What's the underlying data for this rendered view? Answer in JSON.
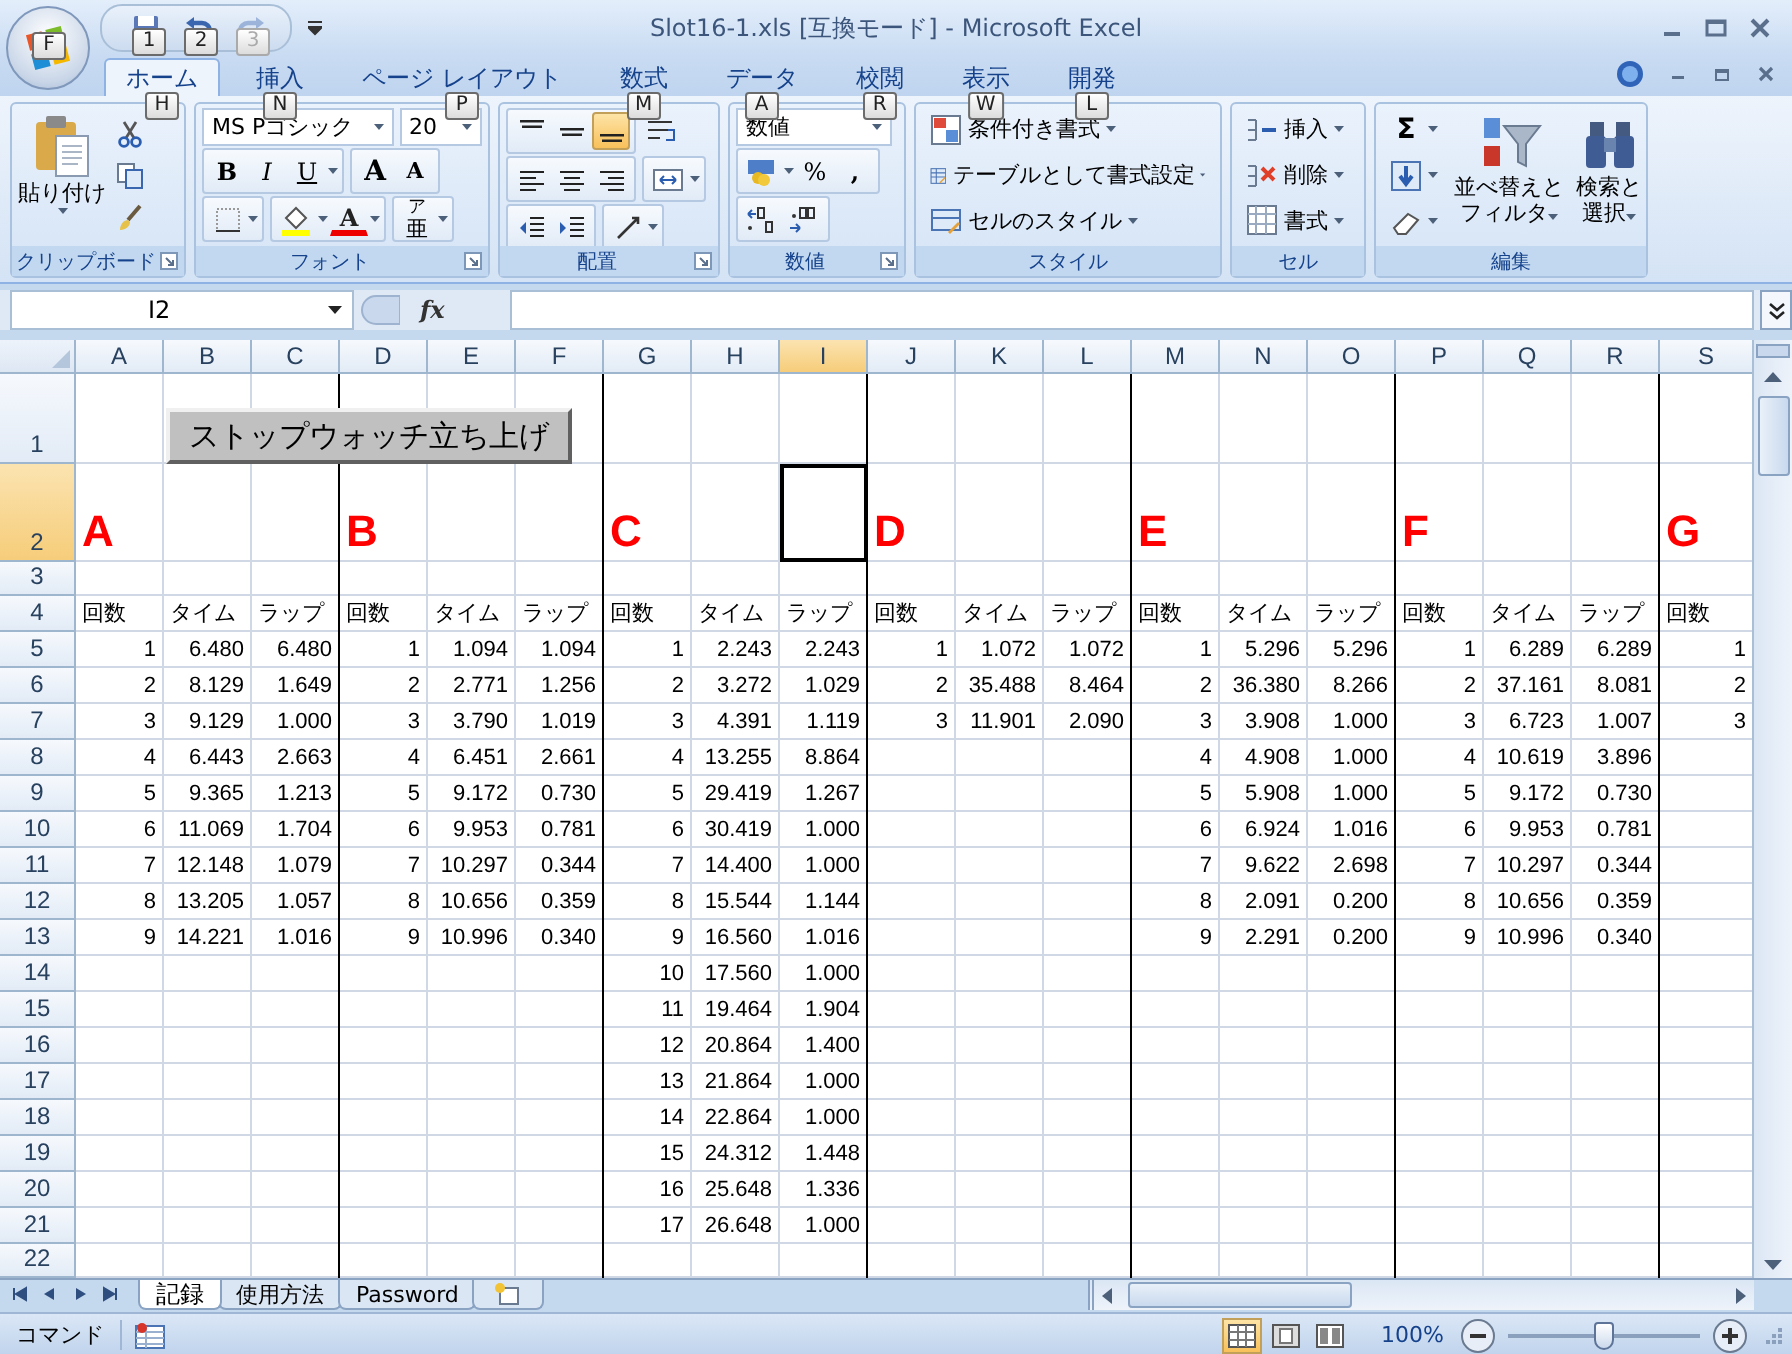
{
  "window": {
    "title": "Slot16-1.xls  [互換モード] - Microsoft Excel"
  },
  "office_button": {
    "keytip": "F"
  },
  "quick_access": [
    {
      "kind": "save",
      "keytip": "1",
      "disabled": false
    },
    {
      "kind": "undo",
      "keytip": "2",
      "disabled": false
    },
    {
      "kind": "redo",
      "keytip": "3",
      "disabled": true
    }
  ],
  "tabs": [
    {
      "label": "ホーム",
      "keytip": "H",
      "selected": true
    },
    {
      "label": "挿入",
      "keytip": "N",
      "selected": false
    },
    {
      "label": "ページ レイアウト",
      "keytip": "P",
      "selected": false
    },
    {
      "label": "数式",
      "keytip": "M",
      "selected": false
    },
    {
      "label": "データ",
      "keytip": "A",
      "selected": false
    },
    {
      "label": "校閲",
      "keytip": "R",
      "selected": false
    },
    {
      "label": "表示",
      "keytip": "W",
      "selected": false
    },
    {
      "label": "開発",
      "keytip": "L",
      "selected": false
    }
  ],
  "ribbon": {
    "clipboard": {
      "title": "クリップボード",
      "paste": "貼り付け"
    },
    "font": {
      "title": "フォント",
      "name": "MS Pゴシック",
      "size": "20",
      "bold": "B",
      "italic": "I",
      "underline": "U",
      "grow": "A",
      "shrink": "A",
      "foreground_button": "A",
      "phonetic": "亜",
      "phonetic_ruby": "ア"
    },
    "alignment": {
      "title": "配置",
      "vertical": [
        {
          "kind": "top",
          "selected": false
        },
        {
          "kind": "middle",
          "selected": false
        },
        {
          "kind": "bottom",
          "selected": true
        }
      ]
    },
    "number": {
      "title": "数値",
      "format": "数値",
      "percent": "%",
      "comma": ","
    },
    "styles": {
      "title": "スタイル",
      "items": [
        {
          "kind": "conditional",
          "label": "条件付き書式"
        },
        {
          "kind": "table",
          "label": "テーブルとして書式設定"
        },
        {
          "kind": "cell_style",
          "label": "セルのスタイル"
        }
      ]
    },
    "cells": {
      "title": "セル",
      "items": [
        {
          "kind": "insert",
          "label": "挿入"
        },
        {
          "kind": "delete",
          "label": "削除"
        },
        {
          "kind": "format",
          "label": "書式"
        }
      ]
    },
    "editing": {
      "title": "編集",
      "sum": "Σ",
      "sort": [
        "並べ替えと",
        "フィルタ"
      ],
      "find": [
        "検索と",
        "選択"
      ]
    }
  },
  "formula_bar": {
    "name_box": "I2",
    "fx_label": "fx"
  },
  "sheet": {
    "button_label": "ストップウォッチ立ち上げ",
    "columns": [
      {
        "label": "A",
        "selected": false
      },
      {
        "label": "B",
        "selected": false
      },
      {
        "label": "C",
        "selected": false
      },
      {
        "label": "D",
        "selected": false
      },
      {
        "label": "E",
        "selected": false
      },
      {
        "label": "F",
        "selected": false
      },
      {
        "label": "G",
        "selected": false
      },
      {
        "label": "H",
        "selected": false
      },
      {
        "label": "I",
        "selected": true
      },
      {
        "label": "J",
        "selected": false
      },
      {
        "label": "K",
        "selected": false
      },
      {
        "label": "L",
        "selected": false
      },
      {
        "label": "M",
        "selected": false
      },
      {
        "label": "N",
        "selected": false
      },
      {
        "label": "O",
        "selected": false
      },
      {
        "label": "P",
        "selected": false
      },
      {
        "label": "Q",
        "selected": false
      },
      {
        "label": "R",
        "selected": false
      },
      {
        "label": "S",
        "selected": false
      }
    ],
    "rows": [
      {
        "label": "1",
        "selected": false
      },
      {
        "label": "2",
        "selected": true
      },
      {
        "label": "3",
        "selected": false
      },
      {
        "label": "4",
        "selected": false
      },
      {
        "label": "5",
        "selected": false
      },
      {
        "label": "6",
        "selected": false
      },
      {
        "label": "7",
        "selected": false
      },
      {
        "label": "8",
        "selected": false
      },
      {
        "label": "9",
        "selected": false
      },
      {
        "label": "10",
        "selected": false
      },
      {
        "label": "11",
        "selected": false
      },
      {
        "label": "12",
        "selected": false
      },
      {
        "label": "13",
        "selected": false
      },
      {
        "label": "14",
        "selected": false
      },
      {
        "label": "15",
        "selected": false
      },
      {
        "label": "16",
        "selected": false
      },
      {
        "label": "17",
        "selected": false
      },
      {
        "label": "18",
        "selected": false
      },
      {
        "label": "19",
        "selected": false
      },
      {
        "label": "20",
        "selected": false
      },
      {
        "label": "21",
        "selected": false
      },
      {
        "label": "22",
        "selected": false
      }
    ],
    "sections": [
      {
        "label": "A",
        "headers": [
          "回数",
          "タイム",
          "ラップ"
        ],
        "rows": [
          [
            "1",
            "6.480",
            "6.480"
          ],
          [
            "2",
            "8.129",
            "1.649"
          ],
          [
            "3",
            "9.129",
            "1.000"
          ],
          [
            "4",
            "6.443",
            "2.663"
          ],
          [
            "5",
            "9.365",
            "1.213"
          ],
          [
            "6",
            "11.069",
            "1.704"
          ],
          [
            "7",
            "12.148",
            "1.079"
          ],
          [
            "8",
            "13.205",
            "1.057"
          ],
          [
            "9",
            "14.221",
            "1.016"
          ]
        ]
      },
      {
        "label": "B",
        "headers": [
          "回数",
          "タイム",
          "ラップ"
        ],
        "rows": [
          [
            "1",
            "1.094",
            "1.094"
          ],
          [
            "2",
            "2.771",
            "1.256"
          ],
          [
            "3",
            "3.790",
            "1.019"
          ],
          [
            "4",
            "6.451",
            "2.661"
          ],
          [
            "5",
            "9.172",
            "0.730"
          ],
          [
            "6",
            "9.953",
            "0.781"
          ],
          [
            "7",
            "10.297",
            "0.344"
          ],
          [
            "8",
            "10.656",
            "0.359"
          ],
          [
            "9",
            "10.996",
            "0.340"
          ]
        ]
      },
      {
        "label": "C",
        "headers": [
          "回数",
          "タイム",
          "ラップ"
        ],
        "rows": [
          [
            "1",
            "2.243",
            "2.243"
          ],
          [
            "2",
            "3.272",
            "1.029"
          ],
          [
            "3",
            "4.391",
            "1.119"
          ],
          [
            "4",
            "13.255",
            "8.864"
          ],
          [
            "5",
            "29.419",
            "1.267"
          ],
          [
            "6",
            "30.419",
            "1.000"
          ],
          [
            "7",
            "14.400",
            "1.000"
          ],
          [
            "8",
            "15.544",
            "1.144"
          ],
          [
            "9",
            "16.560",
            "1.016"
          ],
          [
            "10",
            "17.560",
            "1.000"
          ],
          [
            "11",
            "19.464",
            "1.904"
          ],
          [
            "12",
            "20.864",
            "1.400"
          ],
          [
            "13",
            "21.864",
            "1.000"
          ],
          [
            "14",
            "22.864",
            "1.000"
          ],
          [
            "15",
            "24.312",
            "1.448"
          ],
          [
            "16",
            "25.648",
            "1.336"
          ],
          [
            "17",
            "26.648",
            "1.000"
          ]
        ]
      },
      {
        "label": "D",
        "headers": [
          "回数",
          "タイム",
          "ラップ"
        ],
        "rows": [
          [
            "1",
            "1.072",
            "1.072"
          ],
          [
            "2",
            "35.488",
            "8.464"
          ],
          [
            "3",
            "11.901",
            "2.090"
          ]
        ]
      },
      {
        "label": "E",
        "headers": [
          "回数",
          "タイム",
          "ラップ"
        ],
        "rows": [
          [
            "1",
            "5.296",
            "5.296"
          ],
          [
            "2",
            "36.380",
            "8.266"
          ],
          [
            "3",
            "3.908",
            "1.000"
          ],
          [
            "4",
            "4.908",
            "1.000"
          ],
          [
            "5",
            "5.908",
            "1.000"
          ],
          [
            "6",
            "6.924",
            "1.016"
          ],
          [
            "7",
            "9.622",
            "2.698"
          ],
          [
            "8",
            "2.091",
            "0.200"
          ],
          [
            "9",
            "2.291",
            "0.200"
          ]
        ]
      },
      {
        "label": "F",
        "headers": [
          "回数",
          "タイム",
          "ラップ"
        ],
        "rows": [
          [
            "1",
            "6.289",
            "6.289"
          ],
          [
            "2",
            "37.161",
            "8.081"
          ],
          [
            "3",
            "6.723",
            "1.007"
          ],
          [
            "4",
            "10.619",
            "3.896"
          ],
          [
            "5",
            "9.172",
            "0.730"
          ],
          [
            "6",
            "9.953",
            "0.781"
          ],
          [
            "7",
            "10.297",
            "0.344"
          ],
          [
            "8",
            "10.656",
            "0.359"
          ],
          [
            "9",
            "10.996",
            "0.340"
          ]
        ]
      },
      {
        "label": "G",
        "headers": [
          "回数"
        ],
        "rows": [
          [
            "1"
          ],
          [
            "2"
          ],
          [
            "3"
          ]
        ]
      }
    ]
  },
  "sheet_tabs": [
    {
      "label": "記録",
      "selected": true
    },
    {
      "label": "使用方法",
      "selected": false
    },
    {
      "label": "Password",
      "selected": false
    }
  ],
  "status_bar": {
    "mode": "コマンド",
    "views": [
      {
        "kind": "normal",
        "selected": true
      },
      {
        "kind": "page_layout",
        "selected": false
      },
      {
        "kind": "page_break",
        "selected": false
      }
    ],
    "zoom": "100%",
    "zoom_slider": {
      "level": 0.5
    }
  }
}
